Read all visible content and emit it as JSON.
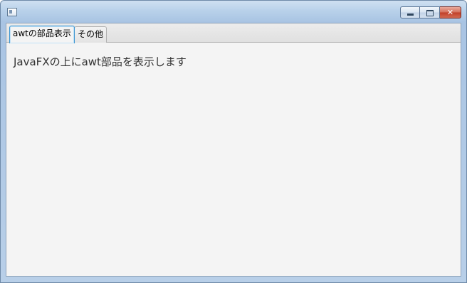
{
  "window": {
    "title": "",
    "icon": "app-window-icon",
    "buttons": {
      "minimize": "minimize-icon",
      "maximize": "maximize-icon",
      "close_label": "✕"
    }
  },
  "tabs": [
    {
      "label": "awtの部品表示",
      "selected": true
    },
    {
      "label": "その他",
      "selected": false
    }
  ],
  "content": {
    "message": "JavaFXの上にawt部品を表示します"
  },
  "colors": {
    "frame": "#b9d1ea",
    "client_bg": "#f4f4f4",
    "tab_focus_border": "#3d96d2",
    "close_button": "#c13f28"
  }
}
